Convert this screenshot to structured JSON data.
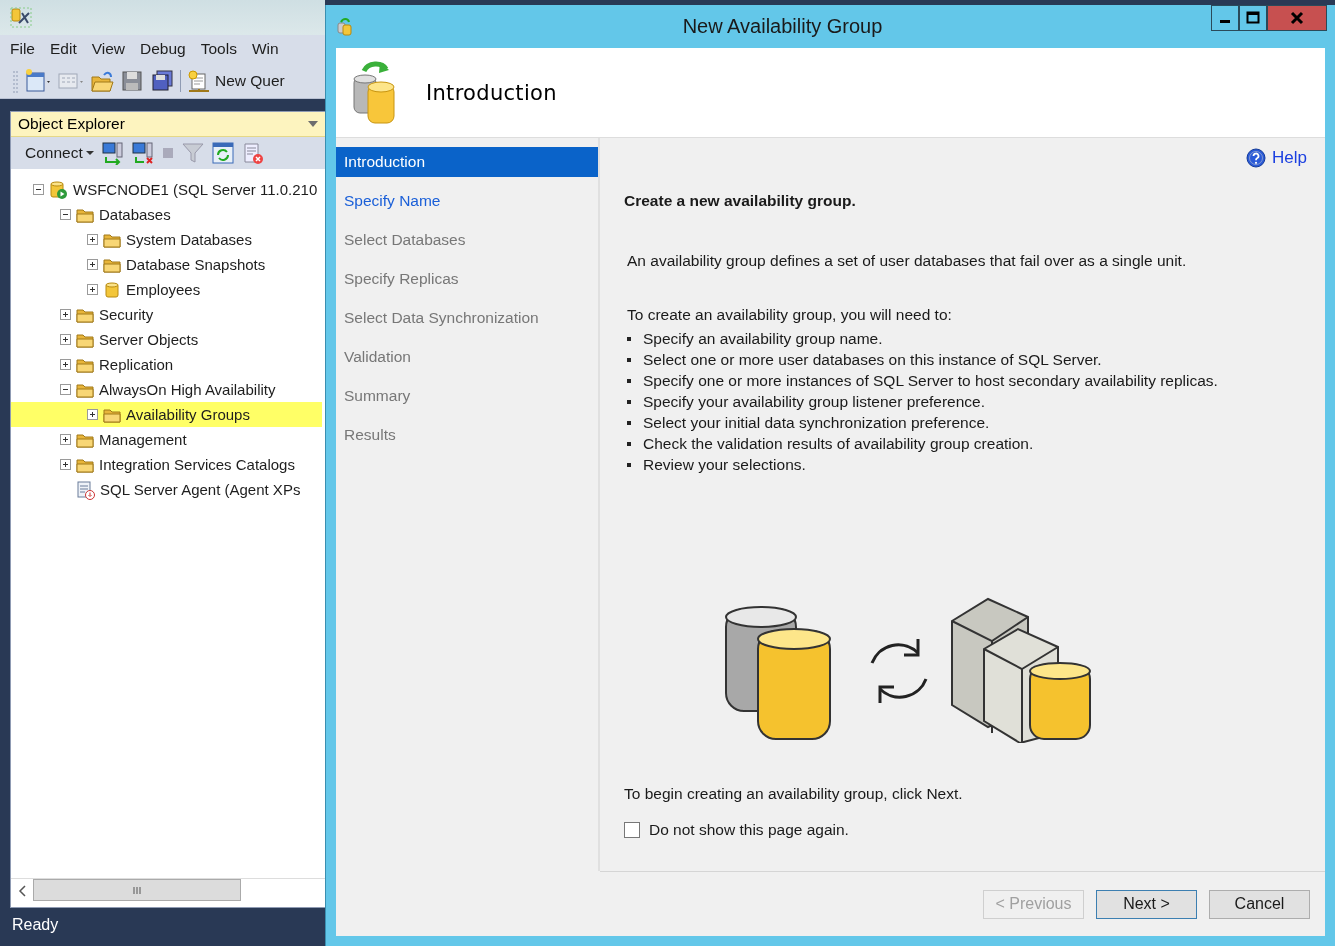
{
  "ssms": {
    "menu": [
      "File",
      "Edit",
      "View",
      "Debug",
      "Tools",
      "Win"
    ],
    "toolbar": {
      "new_query": "New Quer"
    },
    "object_explorer": {
      "title": "Object Explorer",
      "connect": "Connect",
      "tree": [
        {
          "label": "WSFCNODE1 (SQL Server 11.0.210",
          "kind": "server",
          "expanded": true,
          "selected": false,
          "children": [
            {
              "label": "Databases",
              "kind": "folder",
              "expanded": true,
              "selected": false,
              "children": [
                {
                  "label": "System Databases",
                  "kind": "folder",
                  "expanded": false,
                  "selected": false
                },
                {
                  "label": "Database Snapshots",
                  "kind": "folder",
                  "expanded": false,
                  "selected": false
                },
                {
                  "label": "Employees",
                  "kind": "database",
                  "expanded": false,
                  "selected": false
                }
              ]
            },
            {
              "label": "Security",
              "kind": "folder",
              "expanded": false,
              "selected": false
            },
            {
              "label": "Server Objects",
              "kind": "folder",
              "expanded": false,
              "selected": false
            },
            {
              "label": "Replication",
              "kind": "folder",
              "expanded": false,
              "selected": false
            },
            {
              "label": "AlwaysOn High Availability",
              "kind": "folder",
              "expanded": true,
              "selected": false,
              "children": [
                {
                  "label": "Availability Groups",
                  "kind": "folder",
                  "expanded": false,
                  "selected": true
                }
              ]
            },
            {
              "label": "Management",
              "kind": "folder",
              "expanded": false,
              "selected": false
            },
            {
              "label": "Integration Services Catalogs",
              "kind": "folder",
              "expanded": false,
              "selected": false
            },
            {
              "label": "SQL Server Agent (Agent XPs",
              "kind": "agent",
              "selected": false
            }
          ]
        }
      ]
    },
    "status_bar": "Ready"
  },
  "dialog": {
    "title": "New Availability Group",
    "header": "Introduction",
    "steps": [
      {
        "label": "Introduction",
        "selected": true,
        "disabled": false
      },
      {
        "label": "Specify Name",
        "selected": false,
        "disabled": false
      },
      {
        "label": "Select Databases",
        "selected": false,
        "disabled": true
      },
      {
        "label": "Specify Replicas",
        "selected": false,
        "disabled": true
      },
      {
        "label": "Select Data Synchronization",
        "selected": false,
        "disabled": true
      },
      {
        "label": "Validation",
        "selected": false,
        "disabled": true
      },
      {
        "label": "Summary",
        "selected": false,
        "disabled": true
      },
      {
        "label": "Results",
        "selected": false,
        "disabled": true
      }
    ],
    "help": "Help",
    "heading": "Create a new availability group.",
    "intro": "An availability group defines a set of user databases that fail over as a single unit.",
    "list_title": "To create an availability group, you will need to:",
    "bullets": [
      "Specify an availability group name.",
      "Select one or more user databases on this instance of SQL Server.",
      "Specify one or more instances of SQL Server to host secondary availability replicas.",
      "Specify your availability group listener preference.",
      "Select your initial data synchronization preference.",
      "Check the validation results of availability group creation.",
      "Review your selections."
    ],
    "footer_text": "To begin creating an availability group, click Next.",
    "checkbox": {
      "label": "Do not show this page again.",
      "checked": false
    },
    "buttons": [
      {
        "label": "< Previous",
        "disabled": true,
        "default": false
      },
      {
        "label": "Next >",
        "disabled": false,
        "default": true
      },
      {
        "label": "Cancel",
        "disabled": false,
        "default": false
      }
    ]
  }
}
